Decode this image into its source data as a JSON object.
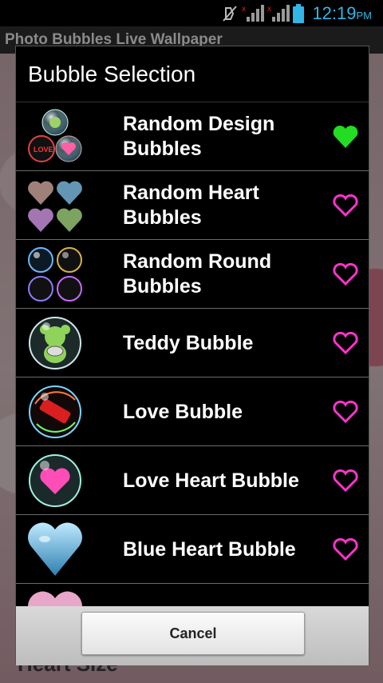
{
  "status_bar": {
    "time": "12:19",
    "ampm": "PM",
    "icons": [
      "mute-icon",
      "signal-no-service-icon",
      "signal-no-service-icon",
      "battery-icon"
    ]
  },
  "background_app": {
    "title": "Photo Bubbles Live Wallpaper",
    "partial_label": "Heart Size"
  },
  "dialog": {
    "title": "Bubble Selection",
    "items": [
      {
        "label": "Random Design Bubbles",
        "selected": true,
        "thumb": "design-bubbles-icon"
      },
      {
        "label": "Random Heart Bubbles",
        "selected": false,
        "thumb": "heart-bubbles-icon"
      },
      {
        "label": "Random Round Bubbles",
        "selected": false,
        "thumb": "round-bubbles-icon"
      },
      {
        "label": "Teddy Bubble",
        "selected": false,
        "thumb": "teddy-bubble-icon"
      },
      {
        "label": "Love Bubble",
        "selected": false,
        "thumb": "love-bubble-icon"
      },
      {
        "label": "Love Heart Bubble",
        "selected": false,
        "thumb": "love-heart-bubble-icon"
      },
      {
        "label": "Blue Heart Bubble",
        "selected": false,
        "thumb": "blue-heart-bubble-icon"
      },
      {
        "label": "",
        "selected": false,
        "thumb": "pink-heart-bubble-icon"
      }
    ],
    "cancel_label": "Cancel"
  },
  "colors": {
    "selected_heart": "#22dd22",
    "unselected_heart": "#ff33cc",
    "status_blue": "#33b5e5"
  }
}
